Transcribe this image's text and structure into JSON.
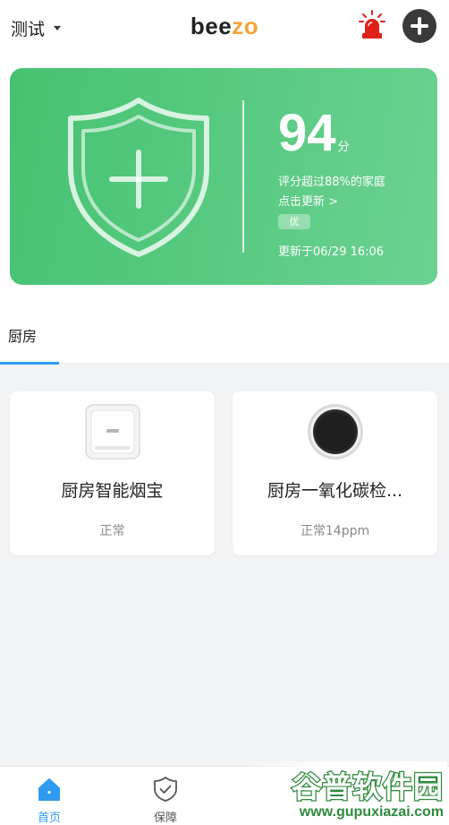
{
  "header": {
    "home_name": "测试",
    "logo_text": "bee",
    "logo_accent": "zo",
    "accent_color": "#f2a43a",
    "alarm_icon": "siren-icon",
    "add_icon": "plus-icon"
  },
  "score_card": {
    "score": "94",
    "unit": "分",
    "description": "评分超过88%的家庭",
    "refresh_link": "点击更新 >",
    "grade": "优",
    "updated": "更新于06/29 16:06",
    "icon": "shield-plus-icon",
    "color": "#45c270"
  },
  "rooms": {
    "active_room": "厨房",
    "active_color": "#2f9bf0"
  },
  "devices": [
    {
      "name": "厨房智能烟宝",
      "status": "正常",
      "icon": "smoke-detector-icon"
    },
    {
      "name": "厨房一氧化碳检...",
      "status": "正常14ppm",
      "icon": "co-detector-icon"
    }
  ],
  "tabbar": {
    "items": [
      {
        "label": "首页",
        "icon": "home-icon",
        "active": true
      },
      {
        "label": "保障",
        "icon": "shield-check-icon",
        "active": false
      }
    ]
  },
  "watermark": {
    "title": "谷普软件园",
    "url": "www.gupuxiazai.com"
  }
}
